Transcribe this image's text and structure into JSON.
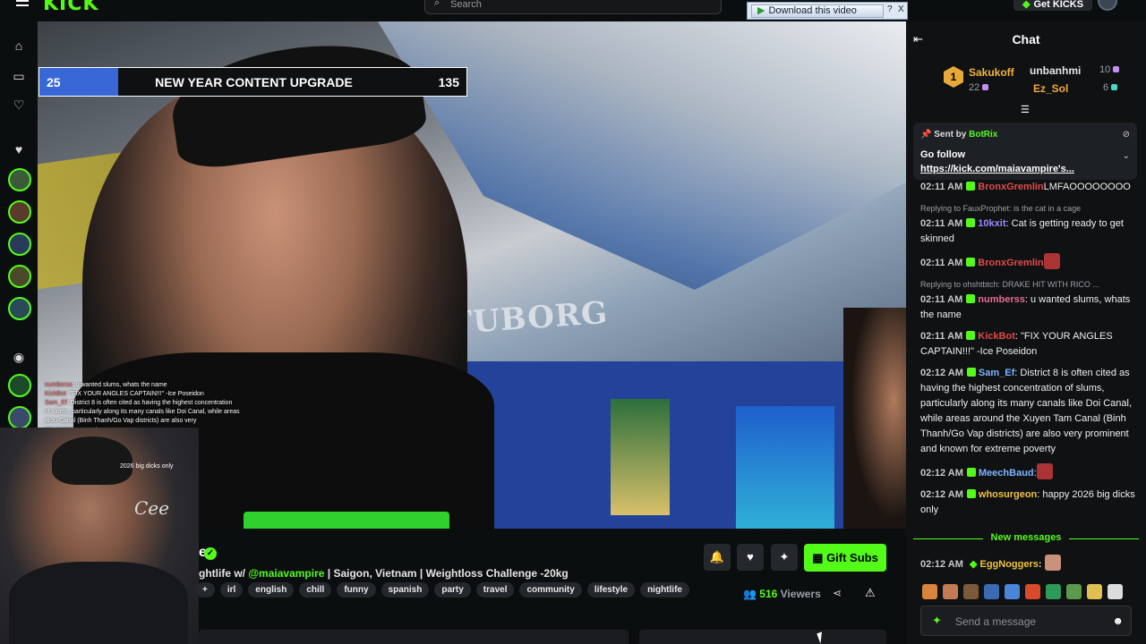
{
  "topbar": {
    "logo": "KICK",
    "search_placeholder": "Search",
    "get_kicks": "Get KICKS"
  },
  "download_overlay": {
    "label": "Download this video",
    "help": "?",
    "close": "X"
  },
  "goal": {
    "current": "25",
    "title": "NEW YEAR CONTENT UPGRADE",
    "target": "135",
    "progress_fraction": 0.185
  },
  "video_overlay_chat": [
    {
      "user": "numberss",
      "text": ": u wanted slums, whats the name"
    },
    {
      "user": "KickBot",
      "text": ": \"FIX YOUR ANGLES CAPTAIN!!!\" -Ice Poseidon"
    },
    {
      "user": "Sam_Ef",
      "text": ": District 8 is often cited as having the highest concentration"
    },
    {
      "user": "",
      "text": "of slums, particularly along its many canals like Doi Canal, while areas"
    },
    {
      "user": "",
      "text": "arou Canal (Binh Thanh/Go Vap districts) are also very"
    },
    {
      "user": "",
      "text": "pro extreme poverty"
    }
  ],
  "webcam": {
    "overlay_text": "2026 big dicks only",
    "watermark": "Cee"
  },
  "stream": {
    "name_fragment": "e",
    "title_prefix": "ghtlife w/ ",
    "mention": "@maiavampire",
    "title_suffix": " | Saigon, Vietnam | Weightloss Challenge -20kg",
    "tags": [
      "+",
      "irl",
      "english",
      "chill",
      "funny",
      "spanish",
      "party",
      "travel",
      "community",
      "lifestyle",
      "nightlife"
    ],
    "viewers_count": "516",
    "viewers_label": " Viewers",
    "gift_subs": "Gift Subs"
  },
  "chat": {
    "header": "Chat",
    "leaderboard": [
      {
        "rank": "1",
        "name": "Sakukoff",
        "count": "22"
      },
      {
        "name": "unbanhmi",
        "count": "10"
      },
      {
        "name": "Ez_Sol",
        "count": "6"
      }
    ],
    "pinned": {
      "sent_by": "Sent by",
      "bot": "BotRix",
      "message": "Go follow",
      "link": "https://kick.com/maiavampire's..."
    },
    "messages": [
      {
        "time": "02:11 AM",
        "user": "BronxGremlin",
        "color": "#e24a4a",
        "text": "LMFAOOOOOOOO",
        "reply": ""
      },
      {
        "time": "02:11 AM",
        "user": "10kxit",
        "color": "#9b8cff",
        "text": ": Cat is getting ready to get skinned",
        "reply": "Replying to FauxProphet: is the cat in a cage"
      },
      {
        "time": "02:11 AM",
        "user": "BronxGremlin",
        "color": "#e24a4a",
        "text": "",
        "reply": ""
      },
      {
        "time": "02:11 AM",
        "user": "numberss",
        "color": "#e86b8f",
        "text": ": u wanted slums, whats the name",
        "reply": "Replying to ohshtbtch: DRAKE HIT WITH RICO ..."
      },
      {
        "time": "02:11 AM",
        "user": "KickBot",
        "color": "#e24a4a",
        "text": ": \"FIX YOUR ANGLES CAPTAIN!!!\" -Ice Poseidon",
        "reply": ""
      },
      {
        "time": "02:12 AM",
        "user": "Sam_Ef",
        "color": "#7fb4ff",
        "text": ": District 8 is often cited as having the highest concentration of slums, particularly along its many canals like Doi Canal, while areas around the Xuyen Tam Canal (Binh Thanh/Go Vap districts) are also very prominent and known for extreme poverty",
        "reply": ""
      },
      {
        "time": "02:12 AM",
        "user": "MeechBaud",
        "color": "#7fb4ff",
        "text": ":",
        "reply": ""
      },
      {
        "time": "02:12 AM",
        "user": "whosurgeon",
        "color": "#f0c23b",
        "text": ": happy 2026 big dicks only",
        "reply": ""
      }
    ],
    "new_messages": "New messages",
    "last_message": {
      "time": "02:12 AM",
      "user": "EggNoggers",
      "color": "#f0c23b",
      "text": ":"
    },
    "send_placeholder": "Send a message"
  },
  "colors": {
    "accent": "#53fc18",
    "goal_fill": "#3867d6",
    "chat_bg": "#0f1113"
  }
}
